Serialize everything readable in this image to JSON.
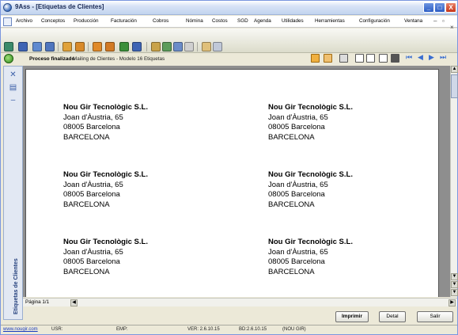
{
  "window": {
    "title": "9Ass - [Etiquetas de Clientes]",
    "minimize": "_",
    "maximize": "□",
    "close": "X"
  },
  "menu": {
    "items": [
      "Archivo",
      "Conceptos",
      "Producción",
      "Facturación",
      "Cobros",
      "Nómina",
      "Costos",
      "SGD",
      "Agenda",
      "Utilidades",
      "Herramientas",
      "Configuración",
      "Ventana"
    ],
    "mdi_min": "–",
    "mdi_max": "▫",
    "mdi_close": "×"
  },
  "status": {
    "main": "Proceso finalizado",
    "subtitle": "Mailing de Clientes - Modelo 16 Etiquetas"
  },
  "sidebar": {
    "vertical_label": "Etiquetas de Clientes"
  },
  "labels": [
    {
      "company": "Nou Gir Tecnològic S.L.",
      "street": "Joan d'Àustria, 65",
      "postal": "08005 Barcelona",
      "city": "BARCELONA"
    },
    {
      "company": "Nou Gir Tecnològic S.L.",
      "street": "Joan d'Àustria, 65",
      "postal": "08005 Barcelona",
      "city": "BARCELONA"
    },
    {
      "company": "Nou Gir Tecnològic S.L.",
      "street": "Joan d'Àustria, 65",
      "postal": "08005 Barcelona",
      "city": "BARCELONA"
    },
    {
      "company": "Nou Gir Tecnològic S.L.",
      "street": "Joan d'Àustria, 65",
      "postal": "08005 Barcelona",
      "city": "BARCELONA"
    },
    {
      "company": "Nou Gir Tecnològic S.L.",
      "street": "Joan d'Àustria, 65",
      "postal": "08005 Barcelona",
      "city": "BARCELONA"
    },
    {
      "company": "Nou Gir Tecnològic S.L.",
      "street": "Joan d'Àustria, 65",
      "postal": "08005 Barcelona",
      "city": "BARCELONA"
    }
  ],
  "pager": {
    "label": "Página 1/1"
  },
  "buttons": {
    "print": "Imprimir",
    "detail": "Detal",
    "exit": "Salir"
  },
  "statusbar": {
    "website": "www.nougir.com",
    "user": "USR:",
    "company": "EMP:",
    "version": "VER: 2.6.10.15",
    "db": "BD:2.6.10.15",
    "org": "(NOU GIR)"
  },
  "colors": {
    "accent": "#3b6dbd",
    "link": "#1a3cc0",
    "close_button": "#c63418"
  }
}
